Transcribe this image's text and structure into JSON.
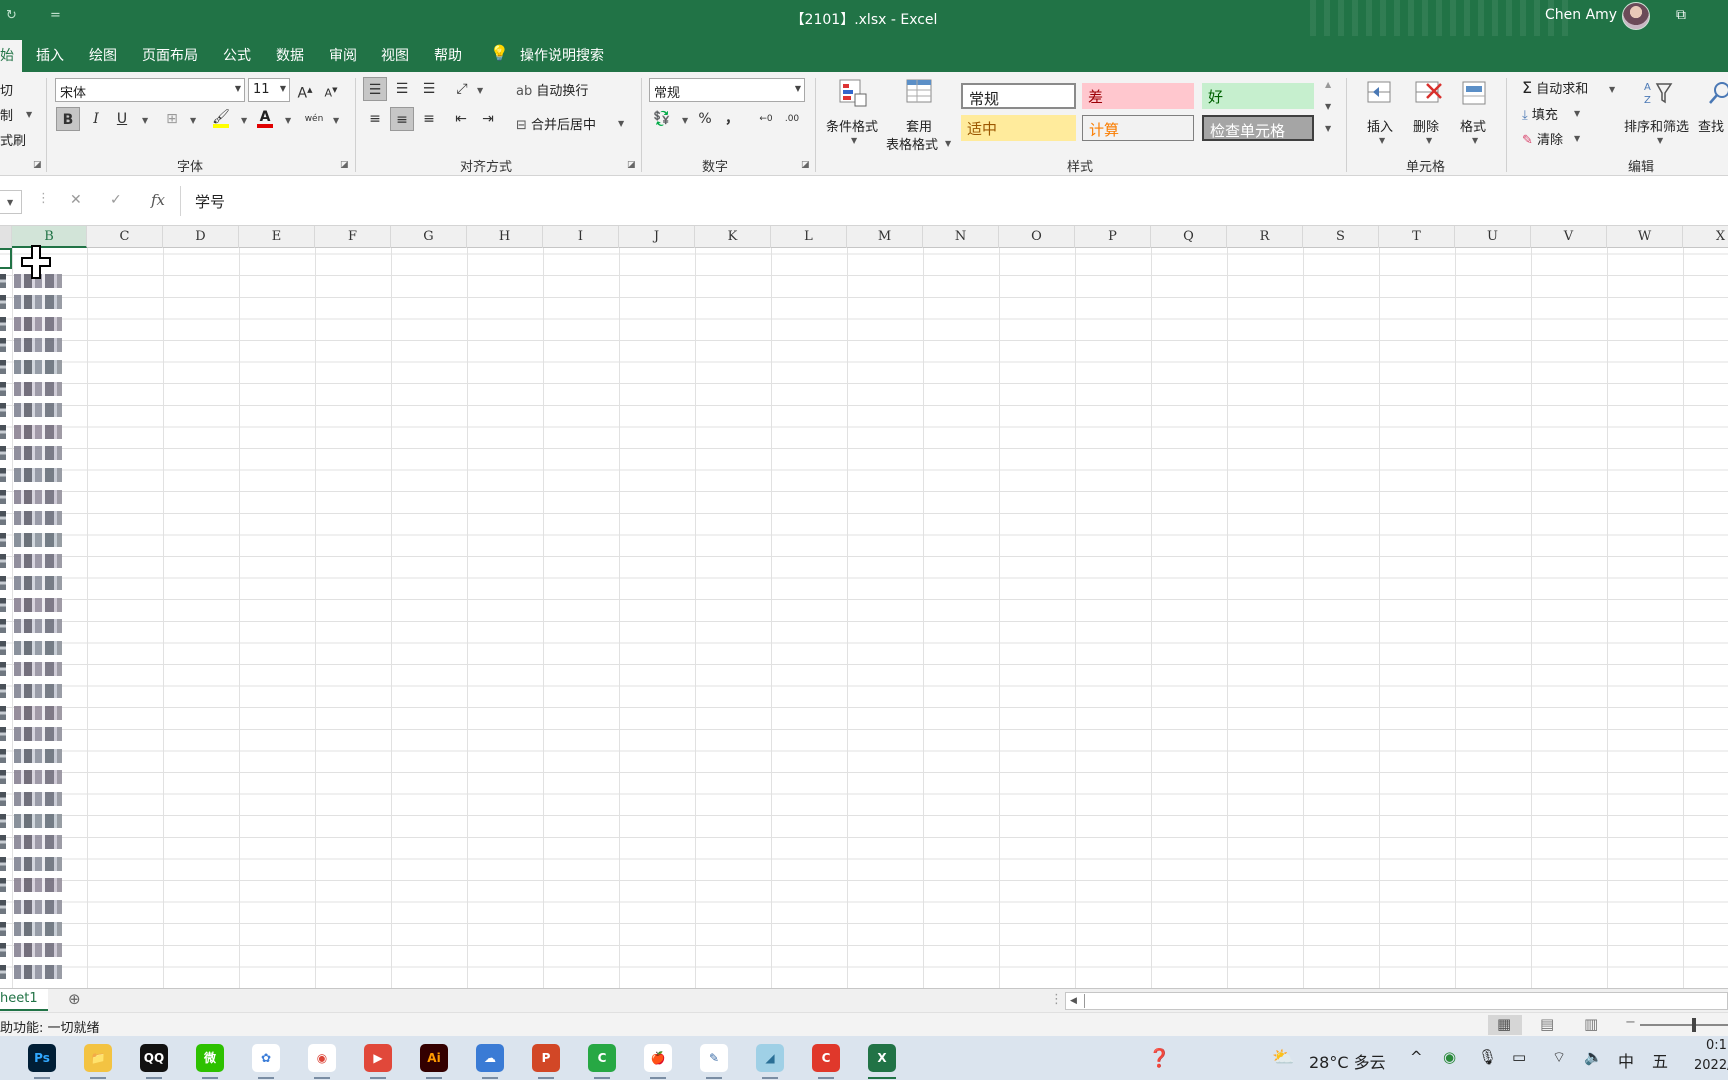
{
  "window": {
    "title": "【2101】.xlsx  -  Excel",
    "user_name": "Chen Amy",
    "qat_redo": "↻",
    "qat_more": "=",
    "restore_icon": "⧉"
  },
  "tabs": [
    {
      "label": "始",
      "active": true
    },
    {
      "label": "插入"
    },
    {
      "label": "绘图"
    },
    {
      "label": "页面布局"
    },
    {
      "label": "公式"
    },
    {
      "label": "数据"
    },
    {
      "label": "审阅"
    },
    {
      "label": "视图"
    },
    {
      "label": "帮助"
    }
  ],
  "tell_me": "操作说明搜索",
  "clipboard": {
    "cut": "切",
    "copy": "制",
    "painter": "式刷"
  },
  "font": {
    "group_label": "字体",
    "name": "宋体",
    "size": "11",
    "grow": "A",
    "shrink": "A",
    "bold": "B",
    "italic": "I",
    "underline": "U",
    "phonetic": "wén"
  },
  "alignment": {
    "group_label": "对齐方式",
    "wrap_text": "自动换行",
    "merge_center": "合并后居中"
  },
  "number": {
    "group_label": "数字",
    "format": "常规",
    "percent": "%",
    "comma": "，",
    "inc_decimal": "←0",
    "dec_decimal": ".00"
  },
  "styles": {
    "group_label": "样式",
    "conditional": "条件格式",
    "format_table_line1": "套用",
    "format_table_line2": "表格格式",
    "cells": [
      {
        "label": "常规",
        "bg": "#ffffff",
        "fg": "#222222"
      },
      {
        "label": "差",
        "bg": "#ffc7ce",
        "fg": "#9c0006"
      },
      {
        "label": "好",
        "bg": "#c6efce",
        "fg": "#006100"
      },
      {
        "label": "适中",
        "bg": "#ffeb9c",
        "fg": "#9c5700"
      },
      {
        "label": "计算",
        "bg": "#f2f2f2",
        "fg": "#fa7d00"
      },
      {
        "label": "检查单元格",
        "bg": "#a5a5a5",
        "fg": "#ffffff"
      }
    ]
  },
  "cells_group": {
    "group_label": "单元格",
    "insert": "插入",
    "delete": "删除",
    "format": "格式"
  },
  "editing": {
    "group_label": "编辑",
    "autosum": "自动求和",
    "fill": "填充",
    "clear": "清除",
    "sort_filter": "排序和筛选",
    "find": "查找"
  },
  "formula_bar": {
    "fx": "fx",
    "cancel": "✕",
    "enter": "✓",
    "content": "学号"
  },
  "columns": [
    "B",
    "C",
    "D",
    "E",
    "F",
    "G",
    "H",
    "I",
    "J",
    "K",
    "L",
    "M",
    "N",
    "O",
    "P",
    "Q",
    "R",
    "S",
    "T",
    "U",
    "V",
    "W",
    "X"
  ],
  "sheet_tab": "heet1",
  "add_sheet": "⊕",
  "status_text": "助功能: 一切就绪",
  "taskbar": {
    "weather": "28°C  多云",
    "ime_lang": "中",
    "ime_mode": "五",
    "clock_time": "0:1",
    "clock_date": "2022/",
    "apps": [
      {
        "label": "Ps",
        "color": "#001e36",
        "fg": "#31a8ff"
      },
      {
        "label": "📁",
        "color": "#f3c342",
        "fg": "#8a5a00"
      },
      {
        "label": "QQ",
        "color": "#111111",
        "fg": "#ffffff"
      },
      {
        "label": "微",
        "color": "#2dc100",
        "fg": "#ffffff"
      },
      {
        "label": "✿",
        "color": "#ffffff",
        "fg": "#3b7dd8"
      },
      {
        "label": "◉",
        "color": "#ffffff",
        "fg": "#db4437"
      },
      {
        "label": "▶",
        "color": "#e1483a",
        "fg": "#ffffff"
      },
      {
        "label": "Ai",
        "color": "#330000",
        "fg": "#ff9a00"
      },
      {
        "label": "☁",
        "color": "#3a7bd5",
        "fg": "#ffffff"
      },
      {
        "label": "P",
        "color": "#d24726",
        "fg": "#ffffff"
      },
      {
        "label": "C",
        "color": "#27a844",
        "fg": "#ffffff"
      },
      {
        "label": "🍎",
        "color": "#ffffff",
        "fg": "#e23b2e"
      },
      {
        "label": "✎",
        "color": "#ffffff",
        "fg": "#3d6ea8"
      },
      {
        "label": "◢",
        "color": "#9fd0e6",
        "fg": "#2a6f96"
      },
      {
        "label": "C",
        "color": "#e0382b",
        "fg": "#ffffff"
      },
      {
        "label": "X",
        "color": "#217346",
        "fg": "#ffffff"
      }
    ]
  }
}
